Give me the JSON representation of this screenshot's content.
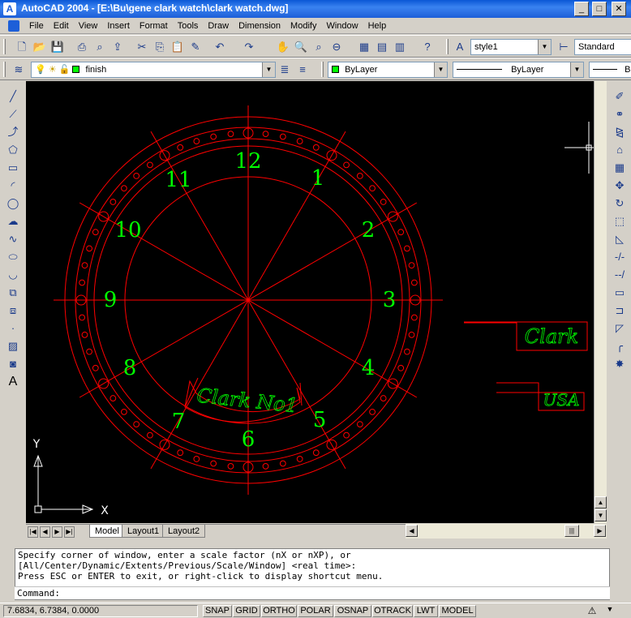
{
  "window": {
    "title": "AutoCAD 2004 - [E:\\Bu\\gene clark watch\\clark watch.dwg]",
    "app_icon": "A",
    "minimize": "_",
    "maximize": "□",
    "close": "✕"
  },
  "menu": [
    "File",
    "Edit",
    "View",
    "Insert",
    "Format",
    "Tools",
    "Draw",
    "Dimension",
    "Modify",
    "Window",
    "Help"
  ],
  "mdi": {
    "minimize": "_",
    "restore": "❐",
    "close": "✕"
  },
  "toolbar_standard": {
    "text_style": "style1",
    "dim_style": "Standard"
  },
  "toolbar_properties": {
    "layer": "finish",
    "color": "ByLayer",
    "linetype": "ByLayer",
    "lineweight": "B"
  },
  "drawing": {
    "numerals": [
      "12",
      "1",
      "2",
      "3",
      "4",
      "5",
      "6",
      "7",
      "8",
      "9",
      "10",
      "11"
    ],
    "brand_arc": "Clark No1",
    "label_clark": "Clark",
    "label_usa": "USA",
    "ucs_x": "X",
    "ucs_y": "Y",
    "colors": {
      "line": "#ff0000",
      "text": "#00ff00",
      "background": "#000000"
    }
  },
  "tabs": [
    "Model",
    "Layout1",
    "Layout2"
  ],
  "command": {
    "lines": [
      "Specify corner of window, enter a scale factor (nX or nXP), or",
      "[All/Center/Dynamic/Extents/Previous/Scale/Window] <real time>:",
      "Press ESC or ENTER to exit, or right-click to display shortcut menu."
    ],
    "prompt": "Command:"
  },
  "status": {
    "coords": "7.6834, 6.7384, 0.0000",
    "buttons": [
      "SNAP",
      "GRID",
      "ORTHO",
      "POLAR",
      "OSNAP",
      "OTRACK",
      "LWT",
      "MODEL"
    ]
  }
}
